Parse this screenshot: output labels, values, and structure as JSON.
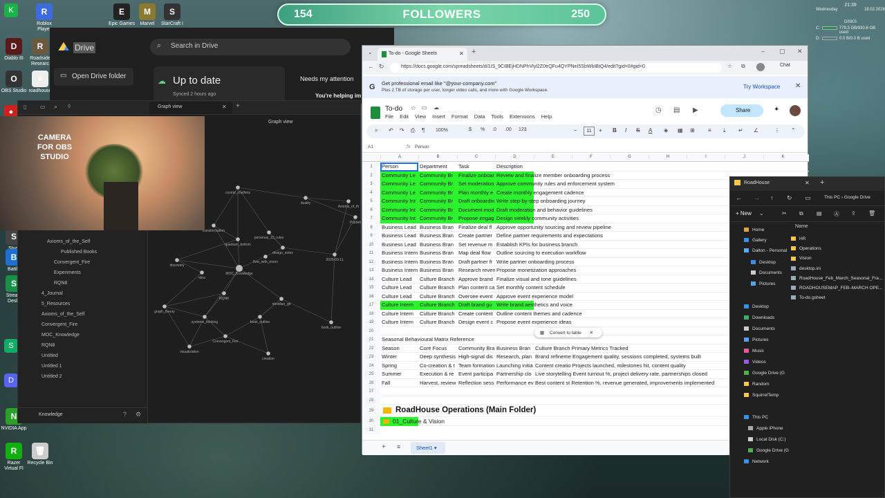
{
  "followers": {
    "left": "154",
    "label": "FOLLOWERS",
    "right": "250"
  },
  "desktop": {
    "icons": [
      {
        "label": "Roblox Player",
        "color": "#3d6ce0",
        "glyph": "R"
      },
      {
        "label": "Epic Games",
        "color": "#222",
        "glyph": "E"
      },
      {
        "label": "Marvel",
        "color": "#8a7a30",
        "glyph": "M"
      },
      {
        "label": "StarCraft I",
        "color": "#333",
        "glyph": "S"
      },
      {
        "label": "Diablo III",
        "color": "#5a1a1a",
        "glyph": "D"
      },
      {
        "label": "Roadside Researc",
        "color": "#6a5a40",
        "glyph": "R"
      },
      {
        "label": "OBS Studio",
        "color": "#333",
        "glyph": "O"
      },
      {
        "label": "roadhouse",
        "color": "#eee",
        "glyph": "≡"
      },
      {
        "label": "Studi",
        "color": "#444",
        "glyph": "S"
      },
      {
        "label": "Battle",
        "color": "#1f6fd0",
        "glyph": "B"
      },
      {
        "label": "Stream Deskt",
        "color": "#1b8f4a",
        "glyph": "S"
      },
      {
        "label": "NVIDIA App",
        "color": "#2aa02a",
        "glyph": "N"
      },
      {
        "label": "Razer Virtual Fl",
        "color": "#10b010",
        "glyph": "R"
      },
      {
        "label": "Recycle Bin",
        "color": "#ccc",
        "glyph": "🗑"
      }
    ]
  },
  "drive": {
    "title": "Drive",
    "search": "Search in Drive",
    "open": "Open Drive folder",
    "status": "Up to date",
    "synced": "Synced 2 hours ago",
    "attention": "Needs my attention",
    "help": "You're helping im"
  },
  "obsidian": {
    "tab": "Graph view",
    "title": "Graph view",
    "vault": "Knowledge",
    "tree": [
      "Axioms_of_the_Self",
      "Published Books",
      "Convergent_Fire",
      "Experiments",
      "RQN8",
      "4_Journal",
      "5_Resources",
      "Axioms_of_the_Self",
      "Convergent_Fire",
      "MOC_Knowledge",
      "RQN8",
      "Untitled",
      "Untitled 1",
      "Untitled 2"
    ],
    "nodes": [
      "cosmic_rhythms",
      "duality",
      "Axioms_of_th",
      "Publish",
      "transformation",
      "personas_12_rules",
      "quantum_bottom",
      "design_notes",
      "flow_with_moon",
      "discovery",
      "MOC_Knowledge",
      "2025-03-11",
      "idea",
      "RQN8",
      "obsidian_git",
      "graph_theory",
      "systems_thinking",
      "book_outline",
      "book_outline",
      "Convergent_Fire",
      "visualization",
      "creation"
    ]
  },
  "camera": {
    "label": "CAMERA FOR OBS STUDIO"
  },
  "sheets": {
    "tab_title": "To-do - Google Sheets",
    "url": "https://docs.google.com/spreadsheets/d/1IS_9CIBEjHDNPhVlyl2Z0trQFu4QYPNeI5SbWbIBtQ4/edit?gid=0#gid=0",
    "promo_title": "Get professional email like \"@your-company.com\"",
    "promo_sub": "Plus 2 TB of storage per user, longer video calls, and more with Google Workspace.",
    "promo_btn": "Try Workspace",
    "doc_title": "To-do",
    "menus": [
      "File",
      "Edit",
      "View",
      "Insert",
      "Format",
      "Data",
      "Tools",
      "Extensions",
      "Help"
    ],
    "share": "Share",
    "zoom": "100%",
    "fontsize": "11",
    "cellref": "A1",
    "formula": "Person",
    "cols": [
      "A",
      "B",
      "C",
      "D",
      "E",
      "F",
      "G",
      "H",
      "I",
      "J",
      "K"
    ],
    "rows": [
      {
        "n": "1",
        "a": "Person",
        "b": "Department",
        "c": "Task",
        "d": "Description",
        "e": "",
        "green": false
      },
      {
        "n": "2",
        "a": "Community Le",
        "b": "Community Br",
        "c": "Finalize onboar",
        "d": "Review and finalize member onboarding process",
        "e": "",
        "green": true
      },
      {
        "n": "3",
        "a": "Community Le",
        "b": "Community Br",
        "c": "Set moderation",
        "d": "Approve community rules and enforcement system",
        "e": "",
        "green": true
      },
      {
        "n": "4",
        "a": "Community Le",
        "b": "Community Br",
        "c": "Plan monthly e",
        "d": "Create monthly engagement cadence",
        "e": "",
        "green": true
      },
      {
        "n": "5",
        "a": "Community Int",
        "b": "Community Br",
        "c": "Draft onboardin",
        "d": "Write step-by-step onboarding journey",
        "e": "",
        "green": true
      },
      {
        "n": "6",
        "a": "Community Int",
        "b": "Community Br",
        "c": "Document mod",
        "d": "Draft moderation and behavior guidelines",
        "e": "",
        "green": true
      },
      {
        "n": "7",
        "a": "Community Int",
        "b": "Community Br",
        "c": "Propose engag",
        "d": "Design weekly community activities",
        "e": "",
        "green": true
      },
      {
        "n": "8",
        "a": "Business Lead",
        "b": "Business Bran",
        "c": "Finalize deal fl",
        "d": "Approve opportunity sourcing and review pipeline",
        "e": "",
        "green": false
      },
      {
        "n": "9",
        "a": "Business Lead",
        "b": "Business Bran",
        "c": "Create partner",
        "d": "Define partner requirements and expectations",
        "e": "",
        "green": false
      },
      {
        "n": "10",
        "a": "Business Lead",
        "b": "Business Bran",
        "c": "Set revenue m",
        "d": "Establish KPIs for business branch",
        "e": "",
        "green": false
      },
      {
        "n": "11",
        "a": "Business Intern",
        "b": "Business Bran",
        "c": "Map deal flow",
        "d": "Outline sourcing to execution workflow",
        "e": "",
        "green": false
      },
      {
        "n": "12",
        "a": "Business Intern",
        "b": "Business Bran",
        "c": "Draft partner fr",
        "d": "Write partner onboarding process",
        "e": "",
        "green": false
      },
      {
        "n": "13",
        "a": "Business Intern",
        "b": "Business Bran",
        "c": "Research reven",
        "d": "Propose monetization approaches",
        "e": "",
        "green": false
      },
      {
        "n": "14",
        "a": "Culture Lead",
        "b": "Culture Branch",
        "c": "Approve brand",
        "d": "Finalize visual and tone guidelines",
        "e": "",
        "green": false
      },
      {
        "n": "15",
        "a": "Culture Lead",
        "b": "Culture Branch",
        "c": "Plan content ca",
        "d": "Set monthly content schedule",
        "e": "",
        "green": false
      },
      {
        "n": "16",
        "a": "Culture Lead",
        "b": "Culture Branch",
        "c": "Oversee event",
        "d": "Approve event experience model",
        "e": "",
        "green": false
      },
      {
        "n": "17",
        "a": "Culture Intern",
        "b": "Culture Branch",
        "c": "Draft brand gu",
        "d": "Write brand aesthetics and voice",
        "e": "",
        "green": true
      },
      {
        "n": "18",
        "a": "Culture Intern",
        "b": "Culture Branch",
        "c": "Create content",
        "d": "Outline content themes and cadence",
        "e": "",
        "green": false
      },
      {
        "n": "19",
        "a": "Culture Intern",
        "b": "Culture Branch",
        "c": "Design event c",
        "d": "Propose event experience ideas",
        "e": "",
        "green": false
      },
      {
        "n": "20",
        "a": "",
        "b": "",
        "c": "",
        "d": "",
        "e": "",
        "green": false
      },
      {
        "n": "21",
        "a": "Seasonal Behavioural Matrix Reference",
        "b": "",
        "c": "",
        "d": "",
        "e": "",
        "green": false
      },
      {
        "n": "22",
        "a": "Season",
        "b": "Core Focus",
        "c": "Community Bra",
        "d": "Business Bran",
        "e": "Culture Branch Primary Metrics Tracked",
        "green": false
      },
      {
        "n": "23",
        "a": "Winter",
        "b": "Deep synthesis",
        "c": "High-signal dis",
        "d": "Research, plan",
        "e": "Brand refineme Engagement quality, sessions completed, systems built",
        "green": false
      },
      {
        "n": "24",
        "a": "Spring",
        "b": "Co-creation & t",
        "c": "Team formation",
        "d": "Launching initia",
        "e": "Content creatio Projects launched, milestones hit, content quality",
        "green": false
      },
      {
        "n": "25",
        "a": "Summer",
        "b": "Execution & re",
        "c": "Event participa",
        "d": "Partnership clo",
        "e": "Live storytelling Event turnout %, project delivery rate, partnerships closed",
        "green": false
      },
      {
        "n": "26",
        "a": "Fall",
        "b": "Harvest, review",
        "c": "Reflection sess",
        "d": "Performance ev",
        "e": "Best content st Retention %, revenue generated, improvements implemented",
        "green": false
      },
      {
        "n": "27",
        "a": "",
        "b": "",
        "c": "",
        "d": "",
        "e": "",
        "green": false
      },
      {
        "n": "28",
        "a": "",
        "b": "",
        "c": "",
        "d": "",
        "e": "",
        "green": false
      }
    ],
    "row29": "RoadHouse Operations (Main Folder)",
    "row30": "01_Culture & Vision",
    "row31": "",
    "convert": "Convert to table",
    "sheet_tab": "Sheet1"
  },
  "explorer": {
    "title": "RoadHouse",
    "addr": "This PC  ›  Google Drive",
    "new": "New",
    "namecol": "Name",
    "nav": [
      "Home",
      "Gallery",
      "Dalton - Personal",
      "Desktop",
      "Documents",
      "Pictures",
      "Desktop",
      "Downloads",
      "Documents",
      "Pictures",
      "Music",
      "Videos",
      "Google Drive (G",
      "Random",
      "SquirrelTemp",
      "This PC",
      "Apple iPhone",
      "Local Disk (C:)",
      "Google Drive (G",
      "Network"
    ],
    "files": [
      "HR",
      "Operations",
      "Vision",
      "desktop.ini",
      "RoadHouse_Feb_March_Seasonal_Fra...",
      "ROADHOUSEMAP_FEB–MARCH OPE...",
      "To-do.gsheet"
    ]
  },
  "sysmon": {
    "time": "21:39",
    "day": "Wednesday",
    "date": "18.02.2026",
    "disks": "DISKS",
    "c": "779.3 GB/930.6 GB used",
    "d": "0.0 B/0.0 B used"
  }
}
